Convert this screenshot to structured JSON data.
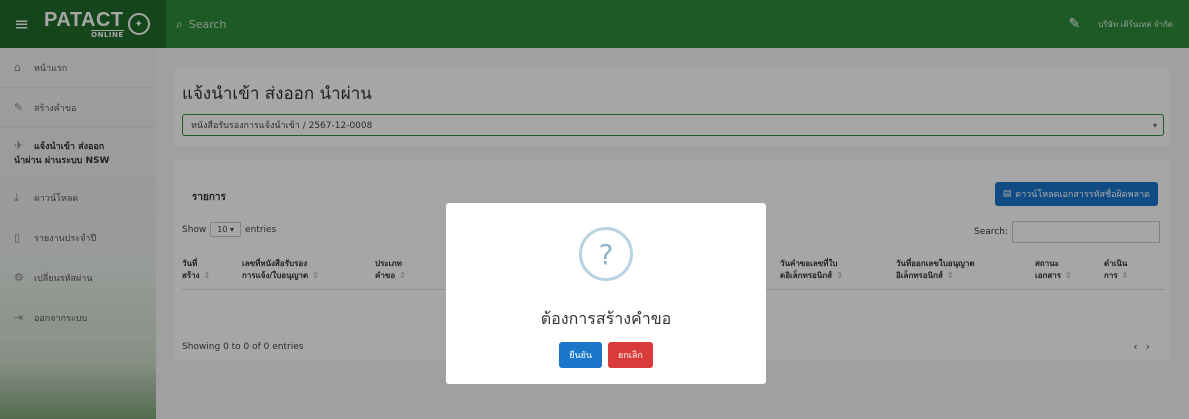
{
  "topbar": {
    "logo_main": "PATACT",
    "logo_sub": "ONLINE",
    "search_placeholder": "Search",
    "user_name": "บริษัท เดิร์นเทส จำกัด"
  },
  "sidebar": {
    "items": [
      {
        "label": "หน้าแรก",
        "icon": "home-icon"
      },
      {
        "label": "สร้างคำขอ",
        "icon": "pencil-icon"
      },
      {
        "label_line1": "แจ้งนำเข้า ส่งออก",
        "label_line2": "นำผ่าน ผ่านระบบ NSW",
        "icon": "plane-icon"
      },
      {
        "label": "ดาวน์โหลด",
        "icon": "download-icon"
      },
      {
        "label": "รายงานประจำปี",
        "icon": "document-icon"
      },
      {
        "label": "เปลี่ยนรหัสผ่าน",
        "icon": "gear-icon"
      },
      {
        "label": "ออกจากระบบ",
        "icon": "logout-icon"
      }
    ]
  },
  "main": {
    "title": "แจ้งนำเข้า ส่งออก นำผ่าน",
    "select_value": "หนังสือรับรองการแจ้งนำเข้า / 2567-12-0008",
    "section_title": "รายการ",
    "download_button": "ดาวน์โหลดเอกสารรหัสชื่อผิดพลาด",
    "show_label": "Show",
    "entries_value": "10",
    "entries_label": "entries",
    "search_label": "Search:",
    "columns": [
      {
        "line1": "วันที่",
        "line2": "สร้าง"
      },
      {
        "line1": "เลขที่หนังสือรับรอง",
        "line2": "การแจ้ง/ใบอนุญาต"
      },
      {
        "line1": "ประเภท",
        "line2": "คำขอ"
      },
      {
        "line1": "วันคำขอเลขที่ใบ",
        "line2": "ดอิเล็กทรอนิกส์"
      },
      {
        "line1": "วันที่ออกเลขใบอนุญาต",
        "line2": "อิเล็กทรอนิกส์"
      },
      {
        "line1": "สถานะ",
        "line2": "เอกสาร"
      },
      {
        "line1": "ดำเนิน",
        "line2": "การ"
      }
    ],
    "showing_text": "Showing 0 to 0 of 0 entries"
  },
  "modal": {
    "message": "ต้องการสร้างคำขอ",
    "confirm_label": "ยืนยัน",
    "cancel_label": "ยกเลิก"
  }
}
